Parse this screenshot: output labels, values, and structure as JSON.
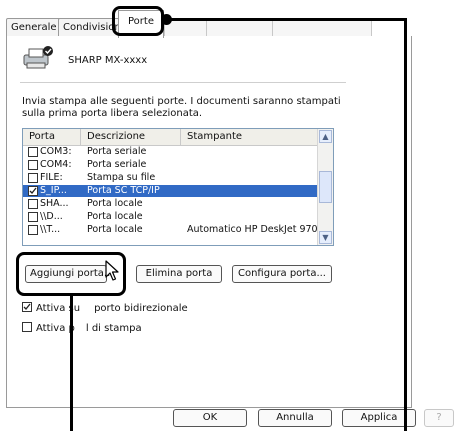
{
  "tabs": [
    "Generale",
    "Condivisione",
    "Porte",
    "",
    "",
    ""
  ],
  "printer_name": "SHARP MX-xxxx",
  "description": "Invia stampa alle seguenti porte. I documenti saranno stampati sulla prima porta libera selezionata.",
  "list": {
    "columns": [
      "Porta",
      "Descrizione",
      "Stampante"
    ],
    "rows": [
      {
        "checked": false,
        "port": "COM3:",
        "desc": "Porta seriale",
        "printer": "",
        "selected": false
      },
      {
        "checked": false,
        "port": "COM4:",
        "desc": "Porta seriale",
        "printer": "",
        "selected": false
      },
      {
        "checked": false,
        "port": "FILE:",
        "desc": "Stampa su file",
        "printer": "",
        "selected": false
      },
      {
        "checked": true,
        "port": "S_IP...",
        "desc": "Porta SC TCP/IP",
        "printer": "",
        "selected": true
      },
      {
        "checked": false,
        "port": "SHA...",
        "desc": "Porta locale",
        "printer": "",
        "selected": false
      },
      {
        "checked": false,
        "port": "\\\\D...",
        "desc": "Porta locale",
        "printer": "",
        "selected": false
      },
      {
        "checked": false,
        "port": "\\\\T...",
        "desc": "Porta locale",
        "printer": "Automatico HP DeskJet 970...",
        "selected": false
      }
    ]
  },
  "buttons": {
    "add_port": "Aggiungi porta...",
    "delete_port": "Elimina porta",
    "configure_port": "Configura porta...",
    "ok": "OK",
    "cancel": "Annulla",
    "apply": "Applica",
    "help": "?"
  },
  "options": {
    "bidirectional": {
      "label_left": "Attiva su",
      "label_right": "porto bidirezionale",
      "checked": true
    },
    "pool": {
      "label_left": "Attiva p",
      "label_right": "l di stampa",
      "checked": false
    }
  },
  "colors": {
    "selection": "#316ac5",
    "callout": "#000000"
  }
}
